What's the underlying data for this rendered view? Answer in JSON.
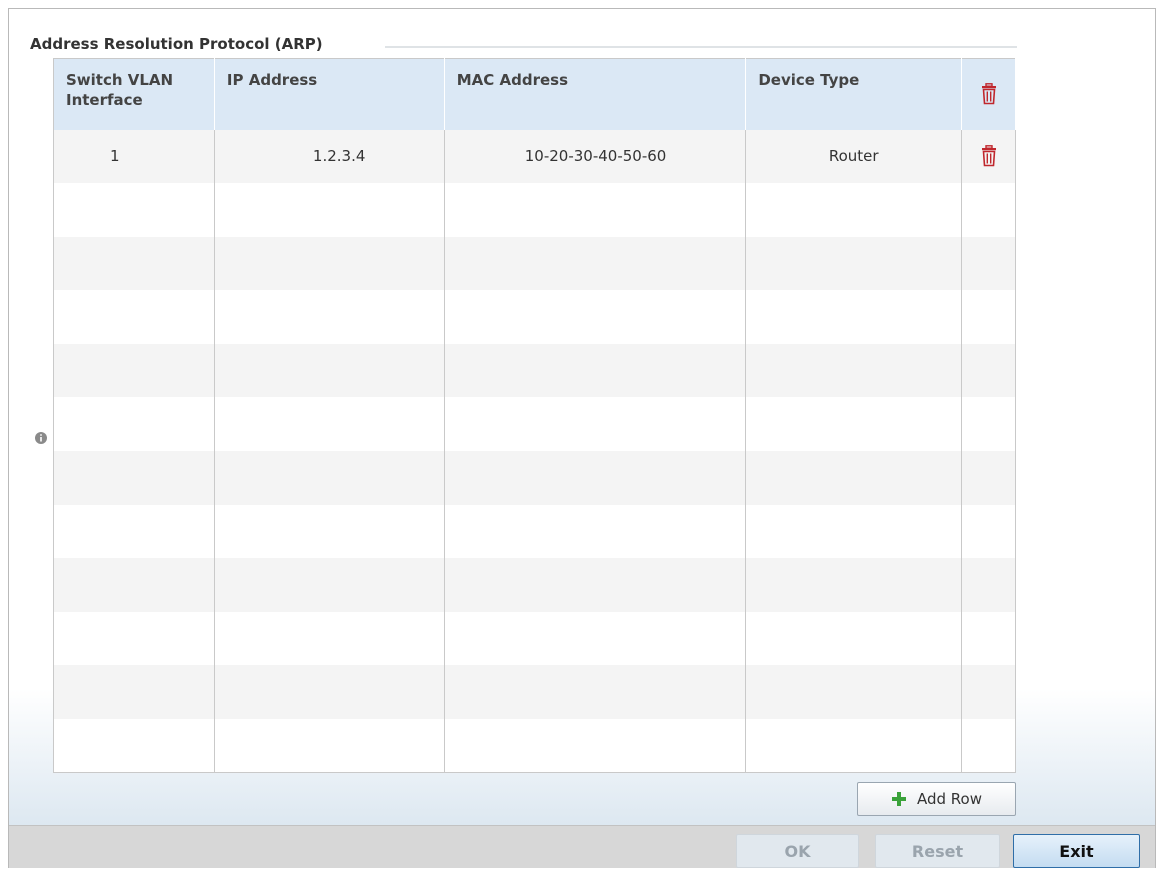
{
  "section": {
    "title": "Address Resolution Protocol (ARP)"
  },
  "table": {
    "columns": [
      "Switch VLAN Interface",
      "IP Address",
      "MAC Address",
      "Device Type"
    ],
    "rows": [
      {
        "vlan": "1",
        "ip": "1.2.3.4",
        "mac": "10-20-30-40-50-60",
        "device_type": "Router"
      }
    ]
  },
  "buttons": {
    "add_row": "Add Row",
    "ok": "OK",
    "reset": "Reset",
    "exit": "Exit"
  },
  "icons": {
    "delete": "trash-icon",
    "add": "plus-icon",
    "info": "info-icon"
  },
  "colors": {
    "header_bg": "#dbe8f5",
    "trash": "#c0272d",
    "plus": "#3aa23a",
    "exit_border": "#2f6ea8"
  }
}
